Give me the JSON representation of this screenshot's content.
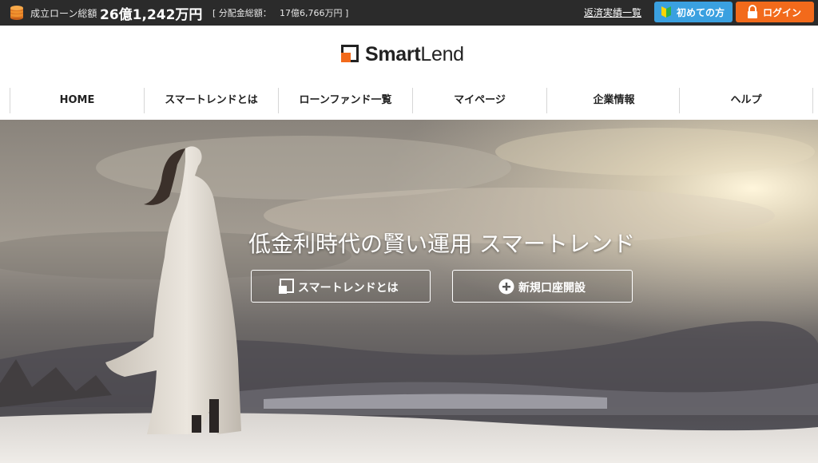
{
  "topbar": {
    "coins_icon": "coin-stack-icon",
    "loan_total_label": "成立ローン総額",
    "loan_total_value": "26億1,242万円",
    "distribution_open": "[",
    "distribution_label": "分配金総額：",
    "distribution_value": "17億6,766万円",
    "distribution_close": "]",
    "repayment_link": "返済実績一覧",
    "first_time_button": "初めての方",
    "first_time_icon": "beginner-mark-icon",
    "login_button": "ログイン",
    "login_icon": "padlock-icon",
    "colors": {
      "bar": "#2b2b2b",
      "first_time": "#3aa0e0",
      "login": "#f26a1b"
    }
  },
  "logo": {
    "icon": "smartlend-square-icon",
    "text_bold": "Smart",
    "text_regular": "Lend",
    "accent_color": "#f26a1b"
  },
  "nav": {
    "items": [
      {
        "label": "HOME"
      },
      {
        "label": "スマートレンドとは"
      },
      {
        "label": "ローンファンド一覧"
      },
      {
        "label": "マイページ"
      },
      {
        "label": "企業情報"
      },
      {
        "label": "ヘルプ"
      }
    ]
  },
  "hero": {
    "headline": "低金利時代の賢い運用 スマートレンド",
    "about_button": "スマートレンドとは",
    "about_icon": "square-logo-icon",
    "signup_button": "新規口座開設",
    "signup_icon": "plus-circle-icon"
  }
}
